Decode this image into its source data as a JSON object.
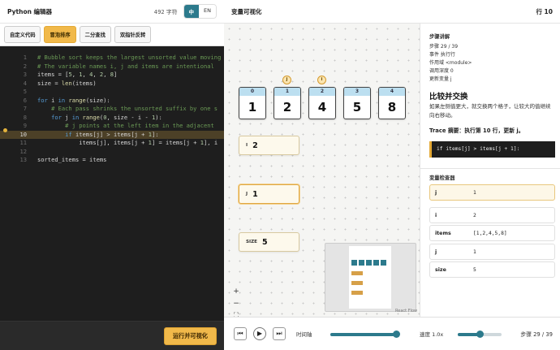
{
  "editor": {
    "title": "Python 编辑器",
    "char_count": "492 字符",
    "lang_zh": "中",
    "lang_en": "EN",
    "tabs": [
      "自定义代码",
      "冒泡排序",
      "二分查找",
      "双指针反转"
    ],
    "active_tab": 1,
    "run_button": "运行并可视化",
    "lines": [
      {
        "n": "1",
        "text": "# Bubble sort keeps the largest unsorted value moving",
        "kind": "comment"
      },
      {
        "n": "2",
        "text": "# The variable names i, j and items are intentional",
        "kind": "comment"
      },
      {
        "n": "3",
        "text": "items = [5, 1, 4, 2, 8]",
        "kind": "code"
      },
      {
        "n": "4",
        "text": "size = len(items)",
        "kind": "code"
      },
      {
        "n": "5",
        "text": "",
        "kind": "code"
      },
      {
        "n": "6",
        "text": "for i in range(size):",
        "kind": "code"
      },
      {
        "n": "7",
        "text": "    # Each pass shrinks the unsorted suffix by one s",
        "kind": "comment"
      },
      {
        "n": "8",
        "text": "    for j in range(0, size - i - 1):",
        "kind": "code"
      },
      {
        "n": "9",
        "text": "        # j points at the left item in the adjacent",
        "kind": "comment"
      },
      {
        "n": "10",
        "text": "        if items[j] > items[j + 1]:",
        "kind": "code"
      },
      {
        "n": "11",
        "text": "            items[j], items[j + 1] = items[j + 1], i",
        "kind": "code"
      },
      {
        "n": "12",
        "text": "",
        "kind": "code"
      },
      {
        "n": "13",
        "text": "sorted_items = items",
        "kind": "code"
      }
    ]
  },
  "viz": {
    "title": "变量可视化",
    "line_indicator": "行 10",
    "array": [
      {
        "index": "0",
        "value": "1"
      },
      {
        "index": "1",
        "value": "2"
      },
      {
        "index": "2",
        "value": "4"
      },
      {
        "index": "3",
        "value": "5"
      },
      {
        "index": "4",
        "value": "8"
      }
    ],
    "pointers": [
      "j",
      "i"
    ],
    "variables": [
      {
        "name": "I",
        "value": "2"
      },
      {
        "name": "J",
        "value": "1"
      },
      {
        "name": "SIZE",
        "value": "5"
      }
    ],
    "zoom_icons": [
      "+",
      "−",
      "⛶",
      "🔒"
    ],
    "react_flow": "React Flow",
    "timeline_label": "时间轴",
    "timeline_progress": 0.97,
    "speed_label": "速度 1.0x",
    "speed_progress": 0.5,
    "step_label": "步骤 29 / 39"
  },
  "panel": {
    "section_title": "步骤讲解",
    "meta": [
      "步骤 29 / 39",
      "事件 执行行",
      "作用域 <module>",
      "调用深度 0",
      "更新变量 j"
    ],
    "heading": "比较并交换",
    "description": "如果左侧值更大，就交换两个格子，让较大的值继续向右移动。",
    "trace": "Trace 摘要：执行第 10 行，更新 j。",
    "code": "if items[j] > items[j + 1]:",
    "inspector_title": "变量检查器",
    "inspector": [
      {
        "name": "j",
        "value": "1"
      },
      {
        "name": "i",
        "value": "2"
      },
      {
        "name": "items",
        "value": "[1,2,4,5,8]"
      },
      {
        "name": "j",
        "value": "1"
      },
      {
        "name": "size",
        "value": "5"
      }
    ]
  }
}
